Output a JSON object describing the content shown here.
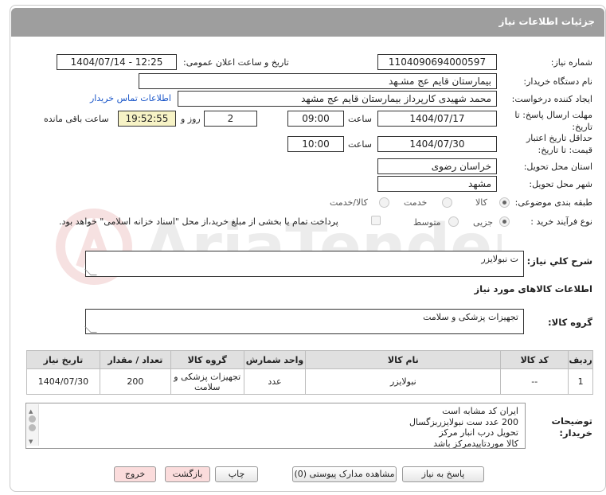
{
  "header": {
    "title": "جزئیات اطلاعات نیاز"
  },
  "fields": {
    "need_number_label": "شماره نیاز:",
    "need_number": "1104090694000597",
    "announce_label": "تاریخ و ساعت اعلان عمومی:",
    "announce_value": "1404/07/14 - 12:25",
    "buyer_org_label": "نام دستگاه خریدار:",
    "buyer_org": "بیمارستان قایم  عج  مشـهد",
    "requester_label": "ایجاد کننده درخواست:",
    "requester": "محمد شهیدی کارپرداز بیمارستان قایم  عج  مشهد",
    "contact_link": "اطلاعات تماس خریدار",
    "deadline_label": "مهلت ارسال پاسخ: تا تاریخ:",
    "deadline_date": "1404/07/17",
    "time_label": "ساعت",
    "deadline_time": "09:00",
    "days_value": "2",
    "days_label": "روز و",
    "remaining_time": "19:52:55",
    "remaining_label": "ساعت باقی مانده",
    "validity_label": "حداقل تاریخ اعتبار قیمت: تا تاریخ:",
    "validity_date": "1404/07/30",
    "validity_time": "10:00",
    "province_label": "استان محل تحویل:",
    "province": "خراسان رضوی",
    "city_label": "شهر محل تحویل:",
    "city": "مشهد",
    "category_label": "طبقه بندی موضوعی:",
    "category_options": [
      "کالا",
      "خدمت",
      "کالا/خدمت"
    ],
    "purchase_label": "نوع فرآیند خرید :",
    "purchase_options": [
      "جزیی",
      "متوسط"
    ],
    "payment_note": "پرداخت تمام یا بخشی از مبلغ خرید،از محل \"اسناد خزانه اسلامی\" خواهد بود."
  },
  "summary": {
    "label": "شرح کلي نياز:",
    "value": "ت نبولایزر"
  },
  "goods_section_title": "اطلاعات کالاهای مورد نیاز",
  "goods_group": {
    "label": "گروه کالا:",
    "value": "تجهیزات پزشکی و سلامت"
  },
  "table": {
    "headers": [
      "ردیف",
      "کد کالا",
      "نام کالا",
      "واحد شمارش",
      "گروه کالا",
      "تعداد / مقدار",
      "تاریخ نیاز"
    ],
    "rows": [
      [
        "1",
        "--",
        "نبولایزر",
        "عدد",
        "تجهیزات پزشکی و سلامت",
        "200",
        "1404/07/30"
      ]
    ]
  },
  "buyer_notes": {
    "label": "توضیحات خریدار:",
    "lines": [
      "ایران کد مشابه است",
      "200 عدد ست نبولایزربزگسال",
      " تحویل درب انبار مرکز",
      "کالا موردتاییدمرکز باشد"
    ]
  },
  "buttons": {
    "reply": "پاسخ به نیاز",
    "docs": "مشاهده مدارک پیوستی (0)",
    "print": "چاپ",
    "back": "بازگشت",
    "exit": "خروج"
  },
  "colors": {
    "header_bg": "#9e9e9e",
    "remaining_bg": "#f7f3c6",
    "link": "#1b57c9",
    "pink_button": "#fbdcdc"
  }
}
